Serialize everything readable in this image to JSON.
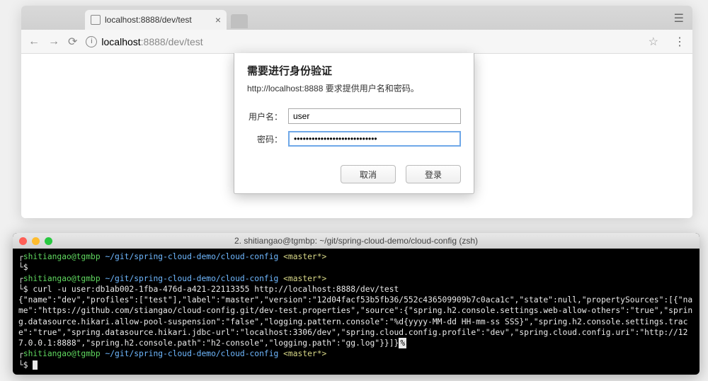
{
  "browser": {
    "tab_title": "localhost:8888/dev/test",
    "url_host": "localhost",
    "url_port_path": ":8888/dev/test"
  },
  "auth": {
    "title": "需要进行身份验证",
    "message": "http://localhost:8888 要求提供用户名和密码。",
    "username_label": "用户名：",
    "password_label": "密码：",
    "username_value": "user",
    "password_value": "••••••••••••••••••••••••••••",
    "cancel": "取消",
    "login": "登录"
  },
  "terminal": {
    "title": "2. shitiangao@tgmbp: ~/git/spring-cloud-demo/cloud-config (zsh)",
    "user": "shitiangao@tgmbp",
    "path": "~/git/spring-cloud-demo/cloud-config",
    "branch": "<master*>",
    "cmd": "curl -u user:db1ab002-1fba-476d-a421-22113355 http://localhost:8888/dev/test",
    "json_output": "{\"name\":\"dev\",\"profiles\":[\"test\"],\"label\":\"master\",\"version\":\"12d04facf53b5fb36/552c436509909b7c0aca1c\",\"state\":null,\"propertySources\":[{\"name\":\"https://github.com/stiangao/cloud-config.git/dev-test.properties\",\"source\":{\"spring.h2.console.settings.web-allow-others\":\"true\",\"spring.datasource.hikari.allow-pool-suspension\":\"false\",\"logging.pattern.console\":\"%d{yyyy-MM-dd HH-mm-ss SSS}\",\"spring.h2.console.settings.trace\":\"true\",\"spring.datasource.hikari.jdbc-url\":\"localhost:3306/dev\",\"spring.cloud.config.profile\":\"dev\",\"spring.cloud.config.uri\":\"http://127.0.0.1:8888\",\"spring.h2.console.path\":\"h2-console\",\"logging.path\":\"gg.log\"}}]}"
  }
}
